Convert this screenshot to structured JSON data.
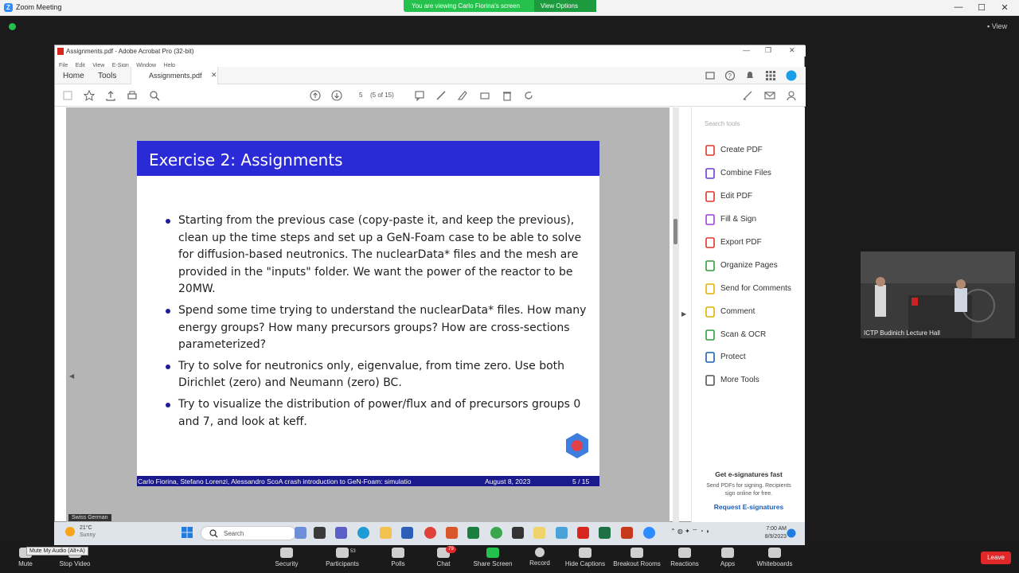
{
  "zoom": {
    "title": "Zoom Meeting",
    "logo": "Z",
    "banner": "You are viewing Carlo Fiorina's screen",
    "view_options": "View Options",
    "view": "View",
    "minimize": "—",
    "maximize": "☐",
    "close": "✕"
  },
  "acrobat": {
    "title": "Assignments.pdf - Adobe Acrobat Pro (32-bit)",
    "menu": [
      "File",
      "Edit",
      "View",
      "E-Sign",
      "Window",
      "Help"
    ],
    "tabs": {
      "home": "Home",
      "tools": "Tools",
      "document": "Assignments.pdf",
      "close": "✕"
    },
    "page_number": "5",
    "page_of": "(5 of 15)",
    "search_tools_placeholder": "Search tools",
    "tools": [
      {
        "label": "Create PDF",
        "icon": "create-pdf-icon",
        "color": "#e0352c"
      },
      {
        "label": "Combine Files",
        "icon": "combine-files-icon",
        "color": "#6b3fd1"
      },
      {
        "label": "Edit PDF",
        "icon": "edit-pdf-icon",
        "color": "#e0352c"
      },
      {
        "label": "Fill & Sign",
        "icon": "fill-sign-icon",
        "color": "#a23fd1"
      },
      {
        "label": "Export PDF",
        "icon": "export-pdf-icon",
        "color": "#e0352c"
      },
      {
        "label": "Organize Pages",
        "icon": "organize-pages-icon",
        "color": "#2f9e3f"
      },
      {
        "label": "Send for Comments",
        "icon": "send-comments-icon",
        "color": "#e6b000"
      },
      {
        "label": "Comment",
        "icon": "comment-icon",
        "color": "#e6b000"
      },
      {
        "label": "Scan & OCR",
        "icon": "scan-ocr-icon",
        "color": "#2f9e3f"
      },
      {
        "label": "Protect",
        "icon": "protect-icon",
        "color": "#1b5fb8"
      },
      {
        "label": "More Tools",
        "icon": "more-tools-icon",
        "color": "#555555"
      }
    ],
    "esign": {
      "heading": "Get e-signatures fast",
      "text": "Send PDFs for signing. Recipients sign online for free.",
      "link": "Request E-signatures"
    }
  },
  "slide": {
    "title": "Exercise 2: Assignments",
    "bullets": [
      "Starting from the previous case (copy-paste it, and keep the previous), clean up the time steps and set up a GeN-Foam case to be able to solve for diffusion-based neutronics. The nuclearData* files and the mesh are provided in the \"inputs\" folder. We want the power of the reactor to be 20MW.",
      "Spend some time trying to understand the nuclearData* files. How many energy groups? How many precursors groups? How are cross-sections parameterized?",
      "Try to solve for neutronics only, eigenvalue, from time zero. Use both Dirichlet (zero) and Neumann (zero) BC.",
      "Try to visualize the distribution of power/flux and of precursors groups 0 and 7, and look at keff."
    ],
    "footer_author": "Carlo Fiorina, Stefano Lorenzi, Alessandro ScoA crash introduction to GeN-Foam: simulatio",
    "footer_date": "August 8, 2023",
    "footer_page": "5 / 15"
  },
  "video": {
    "label": "ICTP Budinich Lecture Hall"
  },
  "taskbar": {
    "locale": "Swiss German",
    "temp": "21°C",
    "condition": "Sunny",
    "search": "Search",
    "time": "7:00 AM",
    "date": "8/9/2023"
  },
  "zoom_bar": {
    "mute_tooltip": "Mute My Audio (Alt+A)",
    "participants_count": "53",
    "chat_count": "79",
    "buttons": [
      {
        "label": "Mute",
        "icon": "microphone-icon"
      },
      {
        "label": "Stop Video",
        "icon": "video-camera-icon"
      },
      {
        "label": "Security",
        "icon": "shield-icon"
      },
      {
        "label": "Participants",
        "icon": "participants-icon"
      },
      {
        "label": "Polls",
        "icon": "polls-icon"
      },
      {
        "label": "Chat",
        "icon": "chat-icon"
      },
      {
        "label": "Share Screen",
        "icon": "share-screen-icon"
      },
      {
        "label": "Record",
        "icon": "record-icon"
      },
      {
        "label": "Hide Captions",
        "icon": "captions-icon"
      },
      {
        "label": "Breakout Rooms",
        "icon": "breakout-rooms-icon"
      },
      {
        "label": "Reactions",
        "icon": "reactions-icon"
      },
      {
        "label": "Apps",
        "icon": "apps-icon"
      },
      {
        "label": "Whiteboards",
        "icon": "whiteboard-icon"
      }
    ],
    "leave": "Leave"
  }
}
